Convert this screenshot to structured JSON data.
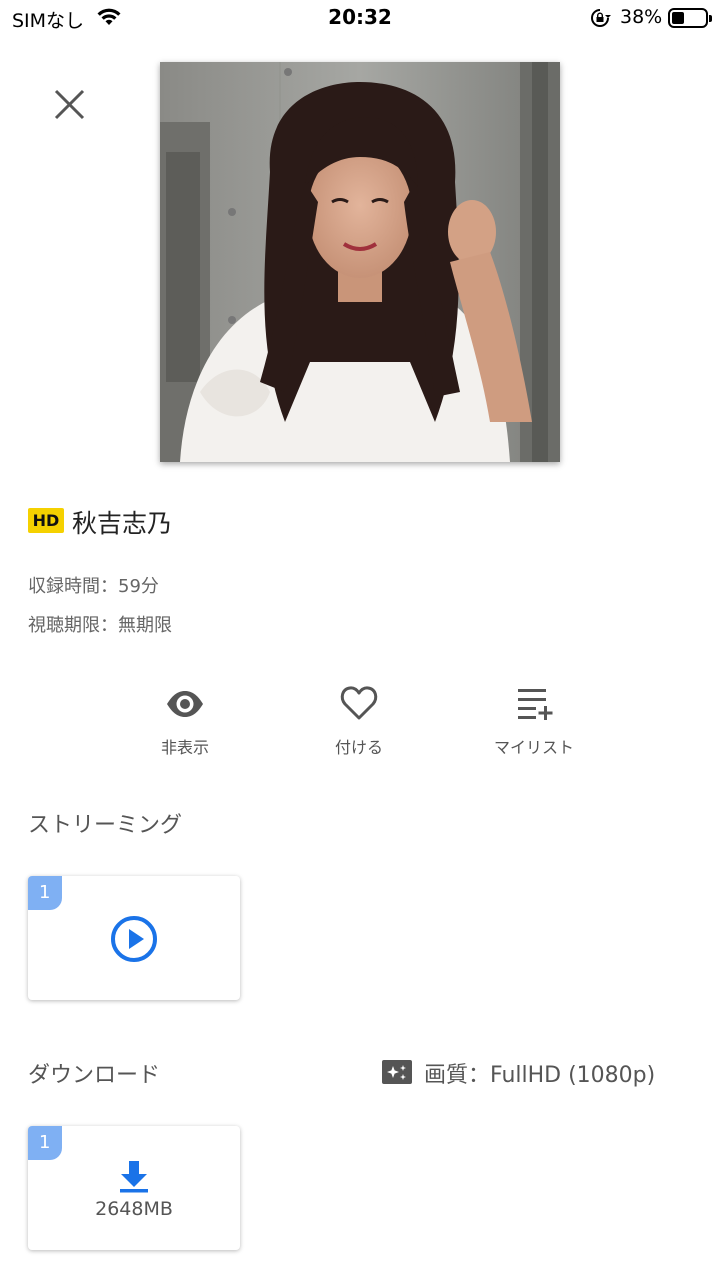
{
  "status_bar": {
    "carrier": "SIMなし",
    "time": "20:32",
    "battery_percent_text": "38%",
    "battery_level": 0.38
  },
  "video": {
    "badge": "HD",
    "title": "秋吉志乃",
    "duration_label": "収録時間：59分",
    "expiry_label": "視聴期限：無期限"
  },
  "actions": {
    "hide_label": "非表示",
    "favorite_label": "付ける",
    "mylist_label": "マイリスト"
  },
  "streaming": {
    "section_title": "ストリーミング",
    "items": [
      {
        "number": "1"
      }
    ]
  },
  "download": {
    "section_title": "ダウンロード",
    "quality_label": "画質：FullHD (1080p)",
    "items": [
      {
        "number": "1",
        "size": "2648MB"
      }
    ]
  },
  "colors": {
    "hd_badge": "#f5d100",
    "accent_blue": "#1a73e8",
    "number_badge": "#7fb0f3"
  }
}
